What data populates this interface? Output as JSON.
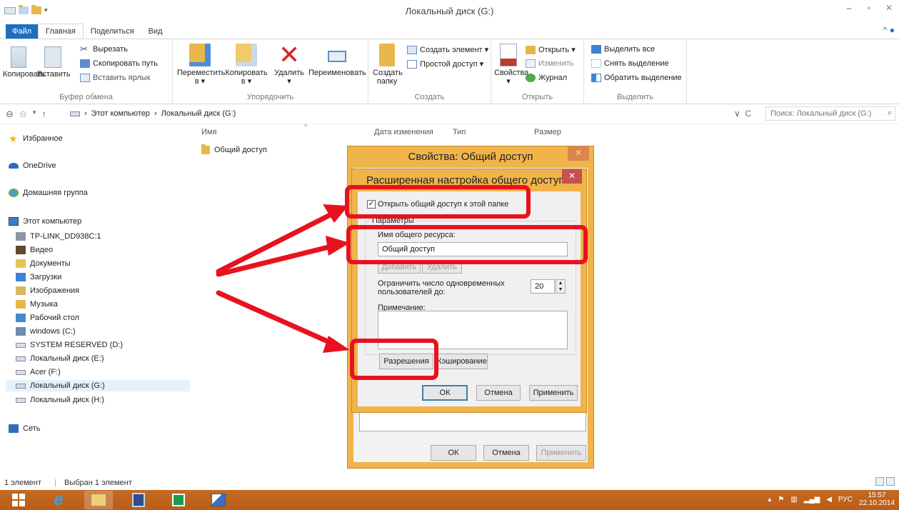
{
  "window": {
    "title": "Локальный диск (G:)"
  },
  "ribbon": {
    "tabs": [
      "Файл",
      "Главная",
      "Поделиться",
      "Вид"
    ],
    "clipboard": {
      "copy": "Копировать",
      "paste": "Вставить",
      "cut": "Вырезать",
      "copy_path": "Скопировать путь",
      "paste_shortcut": "Вставить ярлык",
      "label": "Буфер обмена"
    },
    "organize": {
      "move_line1": "Переместить",
      "move_line2": "в",
      "copy_line1": "Копировать",
      "copy_line2": "в",
      "delete": "Удалить",
      "rename": "Переименовать",
      "label": "Упорядочить"
    },
    "create": {
      "new_folder_line1": "Создать",
      "new_folder_line2": "папку",
      "new_item": "Создать элемент ▾",
      "easy_access": "Простой доступ ▾",
      "label": "Создать"
    },
    "open": {
      "properties": "Свойства",
      "open": "Открыть ▾",
      "edit": "Изменить",
      "history": "Журнал",
      "label": "Открыть"
    },
    "select": {
      "select_all": "Выделить все",
      "select_none": "Снять выделение",
      "invert": "Обратить выделение",
      "label": "Выделить"
    }
  },
  "address": {
    "crumbs": [
      "Этот компьютер",
      "Локальный диск (G:)"
    ],
    "search_placeholder": "Поиск: Локальный диск (G:)"
  },
  "nav": {
    "favorites": "Избранное",
    "onedrive": "OneDrive",
    "homegroup": "Домашняя группа",
    "this_pc": "Этот компьютер",
    "items": [
      "TP-LINK_DD938C:1",
      "Видео",
      "Документы",
      "Загрузки",
      "Изображения",
      "Музыка",
      "Рабочий стол",
      "windows (C:)",
      "SYSTEM RESERVED (D:)",
      "Локальный диск (E:)",
      "Acer (F:)",
      "Локальный диск (G:)",
      "Локальный диск (H:)"
    ],
    "network": "Сеть"
  },
  "filelist": {
    "columns": [
      "Имя",
      "Дата изменения",
      "Тип",
      "Размер"
    ],
    "rows": [
      {
        "name": "Общий доступ"
      }
    ]
  },
  "status": {
    "count": "1 элемент",
    "selected": "Выбран 1 элемент"
  },
  "properties_dialog": {
    "title": "Свойства: Общий доступ",
    "ok": "ОК",
    "cancel": "Отмена",
    "apply": "Применить"
  },
  "advanced_dialog": {
    "title": "Расширенная настройка общего доступа",
    "share_checkbox_label": "Открыть общий доступ к этой папке",
    "share_checked": true,
    "settings_label": "Параметры",
    "share_name_label": "Имя общего ресурса:",
    "share_name_value": "Общий доступ",
    "add": "Добавить",
    "remove": "Удалить",
    "limit_label_line1": "Ограничить число одновременных",
    "limit_label_line2": "пользователей до:",
    "limit_value": "20",
    "comment_label": "Примечание:",
    "permissions": "Разрешения",
    "caching": "Кэширование",
    "ok": "ОК",
    "cancel": "Отмена",
    "apply": "Применить"
  },
  "tray": {
    "lang": "РУС",
    "time": "15:57",
    "date": "22.10.2014"
  },
  "colors": {
    "accent": "#1e6fc1",
    "dialog_frame": "#f0b44a",
    "highlight": "#e8121f",
    "taskbar": "#c0651e"
  }
}
